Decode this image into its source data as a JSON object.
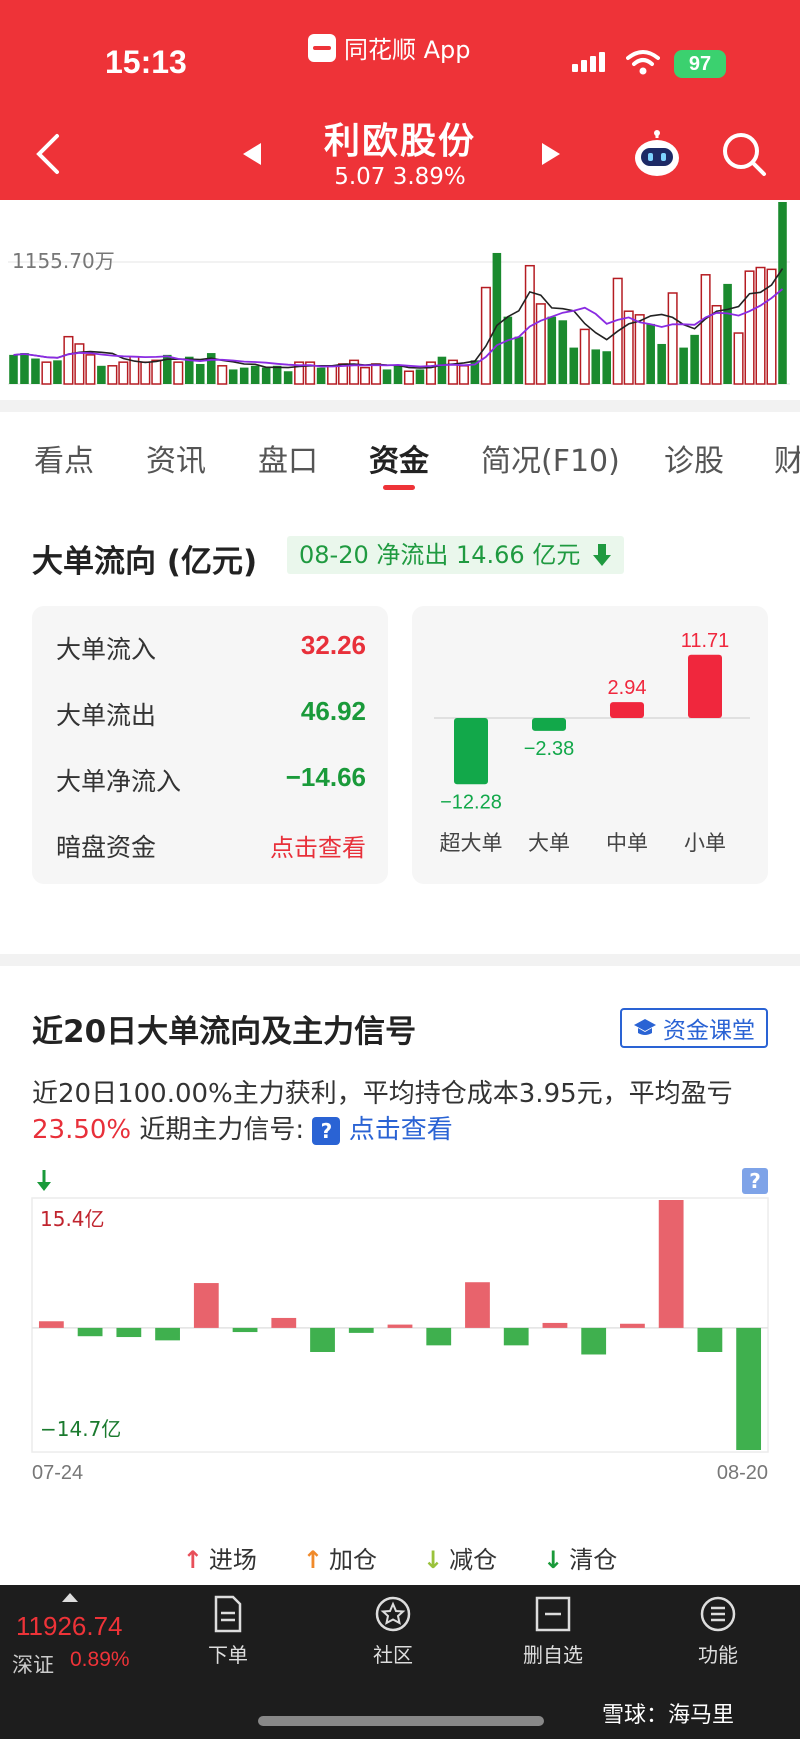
{
  "status_bar": {
    "time": "15:13",
    "app_name": "同花顺 App",
    "battery": "97"
  },
  "header": {
    "stock_name": "利欧股份",
    "price_line": "5.07 3.89%"
  },
  "volume_chart": {
    "max_label": "1155.70万",
    "bars": [
      {
        "v": 0.16,
        "c": "g"
      },
      {
        "v": 0.17,
        "c": "g"
      },
      {
        "v": 0.14,
        "c": "g"
      },
      {
        "v": 0.12,
        "c": "r"
      },
      {
        "v": 0.13,
        "c": "g"
      },
      {
        "v": 0.26,
        "c": "r"
      },
      {
        "v": 0.22,
        "c": "r"
      },
      {
        "v": 0.16,
        "c": "r"
      },
      {
        "v": 0.1,
        "c": "g"
      },
      {
        "v": 0.1,
        "c": "r"
      },
      {
        "v": 0.12,
        "c": "r"
      },
      {
        "v": 0.15,
        "c": "r"
      },
      {
        "v": 0.12,
        "c": "r"
      },
      {
        "v": 0.13,
        "c": "r"
      },
      {
        "v": 0.16,
        "c": "g"
      },
      {
        "v": 0.12,
        "c": "r"
      },
      {
        "v": 0.15,
        "c": "g"
      },
      {
        "v": 0.11,
        "c": "g"
      },
      {
        "v": 0.17,
        "c": "g"
      },
      {
        "v": 0.1,
        "c": "r"
      },
      {
        "v": 0.08,
        "c": "g"
      },
      {
        "v": 0.09,
        "c": "g"
      },
      {
        "v": 0.1,
        "c": "g"
      },
      {
        "v": 0.09,
        "c": "g"
      },
      {
        "v": 0.1,
        "c": "g"
      },
      {
        "v": 0.07,
        "c": "g"
      },
      {
        "v": 0.12,
        "c": "r"
      },
      {
        "v": 0.12,
        "c": "r"
      },
      {
        "v": 0.09,
        "c": "g"
      },
      {
        "v": 0.1,
        "c": "r"
      },
      {
        "v": 0.11,
        "c": "r"
      },
      {
        "v": 0.13,
        "c": "r"
      },
      {
        "v": 0.09,
        "c": "r"
      },
      {
        "v": 0.11,
        "c": "r"
      },
      {
        "v": 0.08,
        "c": "g"
      },
      {
        "v": 0.1,
        "c": "g"
      },
      {
        "v": 0.07,
        "c": "r"
      },
      {
        "v": 0.08,
        "c": "g"
      },
      {
        "v": 0.12,
        "c": "r"
      },
      {
        "v": 0.15,
        "c": "g"
      },
      {
        "v": 0.13,
        "c": "r"
      },
      {
        "v": 0.1,
        "c": "r"
      },
      {
        "v": 0.13,
        "c": "g"
      },
      {
        "v": 0.53,
        "c": "r"
      },
      {
        "v": 0.72,
        "c": "g"
      },
      {
        "v": 0.37,
        "c": "g"
      },
      {
        "v": 0.26,
        "c": "g"
      },
      {
        "v": 0.65,
        "c": "r"
      },
      {
        "v": 0.44,
        "c": "r"
      },
      {
        "v": 0.37,
        "c": "g"
      },
      {
        "v": 0.35,
        "c": "g"
      },
      {
        "v": 0.2,
        "c": "g"
      },
      {
        "v": 0.3,
        "c": "r"
      },
      {
        "v": 0.19,
        "c": "g"
      },
      {
        "v": 0.18,
        "c": "g"
      },
      {
        "v": 0.58,
        "c": "r"
      },
      {
        "v": 0.4,
        "c": "r"
      },
      {
        "v": 0.38,
        "c": "r"
      },
      {
        "v": 0.33,
        "c": "g"
      },
      {
        "v": 0.22,
        "c": "g"
      },
      {
        "v": 0.5,
        "c": "r"
      },
      {
        "v": 0.2,
        "c": "g"
      },
      {
        "v": 0.27,
        "c": "g"
      },
      {
        "v": 0.6,
        "c": "r"
      },
      {
        "v": 0.43,
        "c": "r"
      },
      {
        "v": 0.55,
        "c": "g"
      },
      {
        "v": 0.28,
        "c": "r"
      },
      {
        "v": 0.62,
        "c": "r"
      },
      {
        "v": 0.64,
        "c": "r"
      },
      {
        "v": 0.63,
        "c": "r"
      },
      {
        "v": 1.0,
        "c": "g"
      }
    ]
  },
  "tabs": [
    "看点",
    "资讯",
    "盘口",
    "资金",
    "简况(F10)",
    "诊股",
    "财"
  ],
  "big_order": {
    "title": "大单流向 (亿元)",
    "badge": "08-20 净流出 14.66 亿元",
    "rows": [
      {
        "label": "大单流入",
        "value": "32.26",
        "tone": "red"
      },
      {
        "label": "大单流出",
        "value": "46.92",
        "tone": "green"
      },
      {
        "label": "大单净流入",
        "value": "−14.66",
        "tone": "green"
      },
      {
        "label": "暗盘资金",
        "value": "点击查看",
        "tone": "link"
      }
    ]
  },
  "chart_data": [
    {
      "type": "bar",
      "categories": [
        "超大单",
        "大单",
        "中单",
        "小单"
      ],
      "values": [
        -12.28,
        -2.38,
        2.94,
        11.71
      ],
      "value_labels": [
        "−12.28",
        "−2.38",
        "2.94",
        "11.71"
      ],
      "title": "",
      "xlabel": "",
      "ylabel": ""
    },
    {
      "type": "bar",
      "title": "",
      "x_start_label": "07-24",
      "x_end_label": "08-20",
      "y_max_label": "15.4亿",
      "y_min_label": "−14.7亿",
      "ylim": [
        -14.7,
        15.4
      ],
      "values": [
        0.8,
        -1.0,
        -1.1,
        -1.5,
        5.4,
        -0.5,
        1.2,
        -2.9,
        -0.6,
        0.4,
        -2.1,
        5.5,
        -2.1,
        0.6,
        -3.2,
        0.5,
        15.4,
        -2.9,
        -14.7
      ]
    }
  ],
  "twenty_day": {
    "title": "近20日大单流向及主力信号",
    "class_button": "资金课堂",
    "desc_prefix": "近20日100.00%主力获利，平均持仓成本3.95元，平均盈亏",
    "desc_pct": "23.50%",
    "desc_mid": " 近期主力信号:",
    "desc_link": "点击查看",
    "qmark": "?"
  },
  "legend": [
    {
      "arrow": "↑",
      "label": "进场",
      "color": "#e8505a"
    },
    {
      "arrow": "↑",
      "label": "加仓",
      "color": "#f08a2a"
    },
    {
      "arrow": "↓",
      "label": "减仓",
      "color": "#9ac23c"
    },
    {
      "arrow": "↓",
      "label": "清仓",
      "color": "#1a9a3a"
    }
  ],
  "bottom_bar": {
    "index_value": "11926.74",
    "index_name": "深证",
    "index_pct": "0.89%",
    "nav": [
      "下单",
      "社区",
      "删自选",
      "功能"
    ],
    "watermark": "雪球：海马里"
  },
  "colors": {
    "brand_red": "#ee3338",
    "up_red": "#e8303a",
    "down_green": "#1a9a3a",
    "link_blue": "#2a63d4"
  }
}
